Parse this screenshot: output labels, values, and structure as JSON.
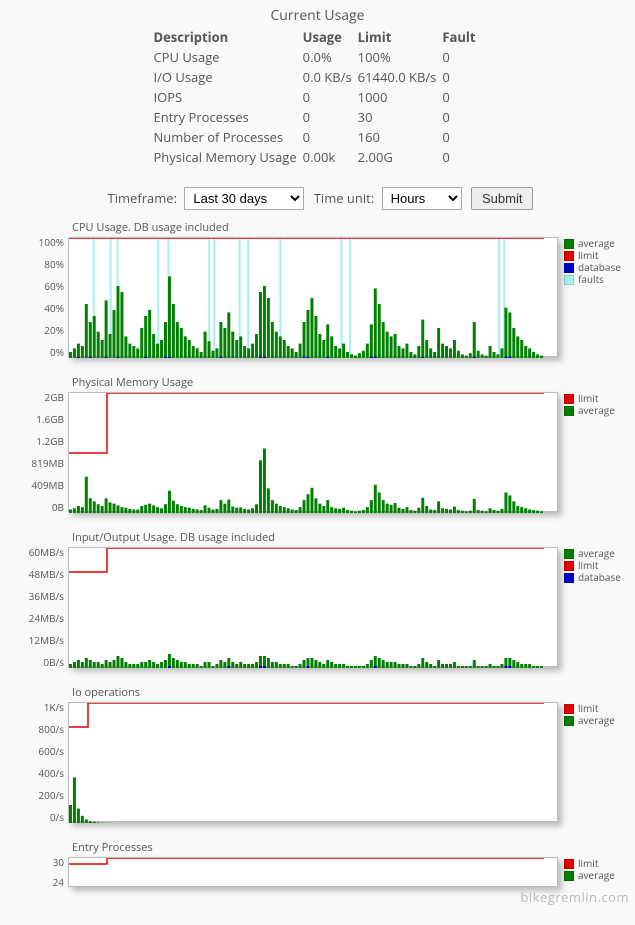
{
  "title": "Current Usage",
  "usage_table": {
    "headers": [
      "Description",
      "Usage",
      "Limit",
      "Fault"
    ],
    "rows": [
      [
        "CPU Usage",
        "0.0%",
        "100%",
        "0"
      ],
      [
        "I/O Usage",
        "0.0 KB/s",
        "61440.0 KB/s",
        "0"
      ],
      [
        "IOPS",
        "0",
        "1000",
        "0"
      ],
      [
        "Entry Processes",
        "0",
        "30",
        "0"
      ],
      [
        "Number of Processes",
        "0",
        "160",
        "0"
      ],
      [
        "Physical Memory Usage",
        "0.00k",
        "2.00G",
        "0"
      ]
    ]
  },
  "controls": {
    "timeframe_label": "Timeframe:",
    "timeframe_value": "Last 30 days",
    "timeunit_label": "Time unit:",
    "timeunit_value": "Hours",
    "submit_label": "Submit"
  },
  "legend_colors": {
    "average": "#008000",
    "limit": "#e60000",
    "database": "#0000c8",
    "faults": "#a8f0f0"
  },
  "watermark": "bikegremlin.com",
  "chart_data": [
    {
      "title": "CPU Usage. DB usage included",
      "type": "line",
      "height": 120,
      "ylabel": "",
      "yticks": [
        "100%",
        "80%",
        "60%",
        "40%",
        "20%",
        "0%"
      ],
      "ylim": [
        0,
        100
      ],
      "limit": 100,
      "limit_step_x": 0,
      "limit_prev": 50,
      "legend": [
        "average",
        "limit",
        "database",
        "faults"
      ],
      "faults_x": [
        14,
        24,
        28,
        52,
        58,
        82,
        85,
        100,
        105,
        124,
        160,
        165,
        253,
        256
      ],
      "series": [
        {
          "name": "average",
          "color": "#008000",
          "values": [
            5,
            8,
            12,
            10,
            45,
            30,
            35,
            22,
            15,
            48,
            20,
            40,
            60,
            55,
            18,
            12,
            10,
            8,
            25,
            35,
            40,
            20,
            12,
            15,
            30,
            68,
            45,
            30,
            25,
            18,
            15,
            10,
            8,
            5,
            22,
            14,
            6,
            8,
            30,
            25,
            38,
            22,
            15,
            18,
            10,
            8,
            12,
            20,
            55,
            60,
            50,
            30,
            22,
            18,
            15,
            10,
            8,
            5,
            12,
            30,
            40,
            50,
            35,
            20,
            15,
            28,
            18,
            10,
            8,
            12,
            5,
            3,
            2,
            4,
            6,
            12,
            28,
            58,
            45,
            30,
            22,
            18,
            20,
            10,
            8,
            12,
            5,
            3,
            10,
            32,
            15,
            8,
            5,
            25,
            12,
            10,
            8,
            15,
            6,
            3,
            2,
            4,
            30,
            6,
            3,
            2,
            10,
            5,
            3,
            8,
            42,
            38,
            25,
            18,
            15,
            10,
            8,
            5,
            3,
            2
          ]
        },
        {
          "name": "database",
          "color": "#0000c8",
          "values": [
            0,
            0,
            1,
            0,
            0,
            1,
            0,
            0,
            0,
            1,
            0,
            0,
            1,
            0,
            0,
            0,
            0,
            0,
            0,
            1,
            0,
            0,
            0,
            0,
            1,
            1,
            0,
            0,
            0,
            0,
            0,
            0,
            0,
            0,
            0,
            0,
            0,
            0,
            1,
            0,
            0,
            0,
            0,
            0,
            0,
            0,
            0,
            0,
            1,
            1,
            0,
            0,
            0,
            0,
            0,
            0,
            0,
            0,
            0,
            1,
            1,
            0,
            0,
            0,
            0,
            1,
            0,
            0,
            0,
            0,
            0,
            0,
            0,
            0,
            0,
            0,
            1,
            1,
            0,
            0,
            0,
            0,
            0,
            0,
            0,
            0,
            0,
            0,
            0,
            1,
            0,
            0,
            0,
            0,
            0,
            0,
            0,
            0,
            0,
            0,
            0,
            0,
            1,
            0,
            0,
            0,
            0,
            0,
            0,
            0,
            1,
            1,
            0,
            0,
            0,
            0,
            0,
            0,
            0,
            0
          ]
        }
      ]
    },
    {
      "title": "Physical Memory Usage",
      "type": "line",
      "height": 120,
      "yticks": [
        "2GB",
        "1.6GB",
        "1.2GB",
        "819MB",
        "409MB",
        "0B"
      ],
      "ylim": [
        0,
        2048
      ],
      "limit": 2048,
      "limit_step_x": 8,
      "limit_prev": 1024,
      "legend": [
        "limit",
        "average"
      ],
      "series": [
        {
          "name": "average",
          "color": "#008000",
          "values": [
            60,
            80,
            120,
            100,
            620,
            250,
            200,
            150,
            120,
            250,
            180,
            160,
            130,
            100,
            90,
            70,
            60,
            60,
            120,
            140,
            160,
            130,
            100,
            80,
            150,
            380,
            210,
            150,
            120,
            100,
            90,
            70,
            60,
            50,
            130,
            90,
            60,
            70,
            220,
            160,
            230,
            110,
            90,
            95,
            70,
            60,
            80,
            150,
            900,
            1100,
            420,
            220,
            160,
            120,
            100,
            80,
            60,
            50,
            100,
            220,
            320,
            430,
            250,
            160,
            120,
            220,
            100,
            80,
            70,
            90,
            50,
            40,
            30,
            40,
            50,
            100,
            220,
            480,
            350,
            220,
            160,
            140,
            170,
            90,
            70,
            100,
            50,
            40,
            90,
            260,
            120,
            60,
            50,
            200,
            80,
            70,
            60,
            110,
            50,
            40,
            30,
            40,
            240,
            50,
            40,
            30,
            80,
            50,
            40,
            70,
            350,
            300,
            200,
            120,
            100,
            80,
            60,
            50,
            40,
            30
          ]
        }
      ]
    },
    {
      "title": "Input/Output Usage. DB usage included",
      "type": "line",
      "height": 120,
      "yticks": [
        "60MB/s",
        "48MB/s",
        "36MB/s",
        "24MB/s",
        "12MB/s",
        "0B/s"
      ],
      "ylim": [
        0,
        60
      ],
      "limit": 60,
      "limit_step_x": 8,
      "limit_prev": 48,
      "legend": [
        "average",
        "limit",
        "database"
      ],
      "series": [
        {
          "name": "average",
          "color": "#008000",
          "values": [
            2,
            3,
            4,
            3,
            5,
            4,
            3,
            3,
            2,
            4,
            3,
            4,
            6,
            5,
            3,
            2,
            2,
            2,
            3,
            3,
            4,
            3,
            2,
            3,
            4,
            7,
            5,
            4,
            3,
            3,
            2,
            2,
            2,
            1,
            3,
            3,
            1,
            2,
            4,
            3,
            5,
            3,
            2,
            3,
            2,
            2,
            2,
            3,
            6,
            6,
            5,
            3,
            3,
            2,
            2,
            2,
            1,
            1,
            2,
            4,
            5,
            5,
            4,
            3,
            2,
            4,
            3,
            2,
            2,
            2,
            1,
            1,
            1,
            1,
            1,
            2,
            4,
            6,
            5,
            4,
            3,
            3,
            3,
            2,
            2,
            2,
            1,
            1,
            2,
            5,
            3,
            2,
            1,
            4,
            2,
            2,
            2,
            3,
            1,
            1,
            1,
            1,
            4,
            1,
            1,
            1,
            2,
            1,
            1,
            2,
            5,
            5,
            4,
            3,
            2,
            2,
            2,
            1,
            1,
            1
          ]
        },
        {
          "name": "database",
          "color": "#0000c8",
          "values": [
            0,
            0,
            0,
            0,
            0,
            0,
            0,
            0,
            0,
            0,
            0,
            0,
            0,
            0,
            0,
            0,
            0,
            0,
            0,
            0,
            0,
            0,
            0,
            0,
            0,
            1,
            0,
            0,
            0,
            0,
            0,
            0,
            0,
            0,
            0,
            0,
            0,
            0,
            0,
            0,
            1,
            0,
            0,
            0,
            0,
            0,
            0,
            0,
            1,
            1,
            0,
            0,
            0,
            0,
            0,
            0,
            0,
            0,
            0,
            0,
            1,
            0,
            0,
            0,
            0,
            0,
            0,
            0,
            0,
            0,
            0,
            0,
            0,
            0,
            0,
            0,
            0,
            1,
            0,
            0,
            0,
            0,
            0,
            0,
            0,
            0,
            0,
            0,
            0,
            0,
            0,
            0,
            0,
            0,
            0,
            0,
            0,
            0,
            0,
            0,
            0,
            0,
            0,
            0,
            0,
            0,
            0,
            0,
            0,
            0,
            1,
            1,
            0,
            0,
            0,
            0,
            0,
            0,
            0,
            0
          ]
        }
      ]
    },
    {
      "title": "Io operations",
      "type": "line",
      "height": 120,
      "yticks": [
        "1K/s",
        "800/s",
        "600/s",
        "400/s",
        "200/s",
        "0/s"
      ],
      "ylim": [
        0,
        1000
      ],
      "limit": 1000,
      "limit_step_x": 4,
      "limit_prev": 800,
      "legend": [
        "limit",
        "average"
      ],
      "series": [
        {
          "name": "average",
          "color": "#008000",
          "values": [
            150,
            380,
            120,
            60,
            30,
            15,
            10,
            5,
            3,
            2,
            1,
            0,
            0,
            0,
            0,
            0,
            0,
            0,
            0,
            0,
            0,
            0,
            0,
            0,
            0,
            0,
            0,
            0,
            0,
            0,
            0,
            0,
            0,
            0,
            0,
            0,
            0,
            0,
            0,
            0,
            0,
            0,
            0,
            0,
            0,
            0,
            0,
            0,
            0,
            0,
            0,
            0,
            0,
            0,
            0,
            0,
            0,
            0,
            0,
            0,
            0,
            0,
            0,
            0,
            0,
            0,
            0,
            0,
            0,
            0,
            0,
            0,
            0,
            0,
            0,
            0,
            0,
            0,
            0,
            0,
            0,
            0,
            0,
            0,
            0,
            0,
            0,
            0,
            0,
            0,
            0,
            0,
            0,
            0,
            0,
            0,
            0,
            0,
            0,
            0,
            0,
            0,
            0,
            0,
            0,
            0,
            0,
            0,
            0,
            0,
            0,
            0,
            0,
            0,
            0,
            0,
            0,
            0,
            0,
            0
          ]
        }
      ]
    },
    {
      "title": "Entry Processes",
      "type": "line",
      "height": 30,
      "yticks": [
        "30",
        "24"
      ],
      "ylim": [
        0,
        30
      ],
      "limit": 30,
      "limit_step_x": 8,
      "limit_prev": 24,
      "legend": [
        "limit",
        "average"
      ],
      "series": [
        {
          "name": "average",
          "color": "#008000",
          "values": [
            0,
            0,
            0,
            0,
            0,
            0,
            0,
            0,
            0,
            0,
            0,
            0,
            0,
            0,
            0,
            0,
            0,
            0,
            0,
            0,
            0,
            0,
            0,
            0,
            0,
            0,
            0,
            0,
            0,
            0,
            0,
            0,
            0,
            0,
            0,
            0,
            0,
            0,
            0,
            0,
            0,
            0,
            0,
            0,
            0,
            0,
            0,
            0,
            0,
            0,
            0,
            0,
            0,
            0,
            0,
            0,
            0,
            0,
            0,
            0,
            0,
            0,
            0,
            0,
            0,
            0,
            0,
            0,
            0,
            0,
            0,
            0,
            0,
            0,
            0,
            0,
            0,
            0,
            0,
            0,
            0,
            0,
            0,
            0,
            0,
            0,
            0,
            0,
            0,
            0,
            0,
            0,
            0,
            0,
            0,
            0,
            0,
            0,
            0,
            0,
            0,
            0,
            0,
            0,
            0,
            0,
            0,
            0,
            0,
            0,
            0,
            0,
            0,
            0,
            0,
            0,
            0,
            0,
            0,
            0
          ]
        }
      ]
    }
  ]
}
